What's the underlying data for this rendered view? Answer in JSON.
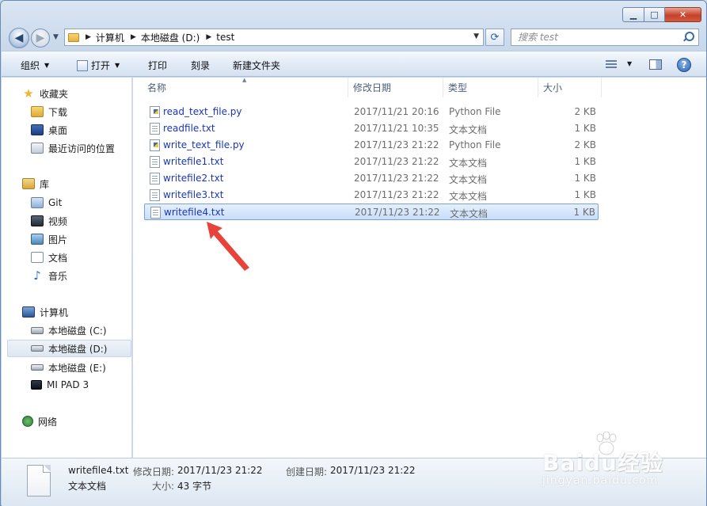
{
  "window": {
    "caption": {
      "minimize": "▁",
      "maximize": "□",
      "close": "✕"
    }
  },
  "address_bar": {
    "crumbs": [
      "计算机",
      "本地磁盘 (D:)",
      "test"
    ],
    "search_placeholder": "搜索 test"
  },
  "command_bar": {
    "organize": "组织",
    "open": "打开",
    "print": "打印",
    "burn": "刻录",
    "new_folder": "新建文件夹"
  },
  "nav_pane": {
    "favorites": {
      "label": "收藏夹",
      "items": [
        "下载",
        "桌面",
        "最近访问的位置"
      ]
    },
    "libraries": {
      "label": "库",
      "items": [
        "Git",
        "视频",
        "图片",
        "文档",
        "音乐"
      ]
    },
    "computer": {
      "label": "计算机",
      "items": [
        "本地磁盘 (C:)",
        "本地磁盘 (D:)",
        "本地磁盘 (E:)",
        "MI PAD 3"
      ],
      "selected": "本地磁盘 (D:)"
    },
    "network": {
      "label": "网络"
    }
  },
  "file_list": {
    "columns": [
      "名称",
      "修改日期",
      "类型",
      "大小"
    ],
    "files": [
      {
        "name": "read_text_file.py",
        "modified": "2017/11/21 20:16",
        "type": "Python File",
        "size": "2 KB",
        "icon": "python-file-icon"
      },
      {
        "name": "readfile.txt",
        "modified": "2017/11/21 10:35",
        "type": "文本文档",
        "size": "1 KB",
        "icon": "text-file-icon"
      },
      {
        "name": "write_text_file.py",
        "modified": "2017/11/23 21:22",
        "type": "Python File",
        "size": "2 KB",
        "icon": "python-file-icon"
      },
      {
        "name": "writefile1.txt",
        "modified": "2017/11/23 21:22",
        "type": "文本文档",
        "size": "1 KB",
        "icon": "text-file-icon"
      },
      {
        "name": "writefile2.txt",
        "modified": "2017/11/23 21:22",
        "type": "文本文档",
        "size": "1 KB",
        "icon": "text-file-icon"
      },
      {
        "name": "writefile3.txt",
        "modified": "2017/11/23 21:22",
        "type": "文本文档",
        "size": "1 KB",
        "icon": "text-file-icon"
      },
      {
        "name": "writefile4.txt",
        "modified": "2017/11/23 21:22",
        "type": "文本文档",
        "size": "1 KB",
        "icon": "text-file-icon"
      }
    ],
    "selected_file": "writefile4.txt"
  },
  "details_pane": {
    "file_name": "writefile4.txt",
    "file_type": "文本文档",
    "modified_label": "修改日期:",
    "modified_value": "2017/11/23 21:22",
    "created_label": "创建日期:",
    "created_value": "2017/11/23 21:22",
    "size_label": "大小:",
    "size_value": "43 字节"
  },
  "watermark": {
    "brand": "Baidu经验",
    "url": "jingyan.baidu.com"
  },
  "colors": {
    "selection_bg": "#cde1fa",
    "link_text": "#1a36b8",
    "annotation_arrow": "#e8423a"
  }
}
